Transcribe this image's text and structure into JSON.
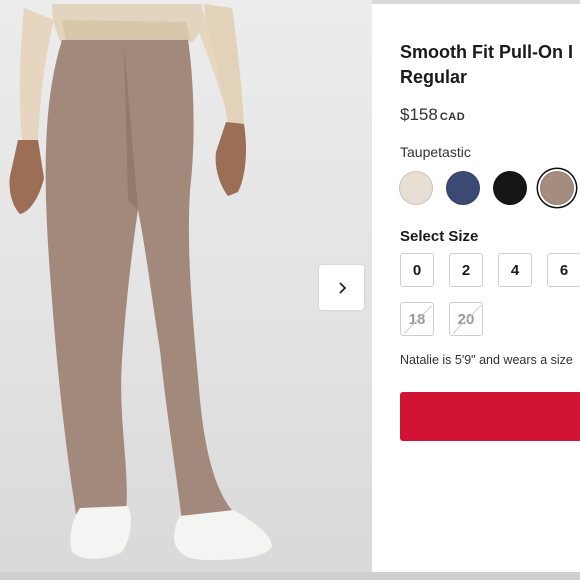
{
  "product": {
    "title_line1": "Smooth Fit Pull-On I",
    "title_line2": "Regular",
    "price": "$158",
    "currency": "CAD"
  },
  "color": {
    "selected_name": "Taupetastic",
    "swatches": [
      {
        "name": "light-beige-swatch",
        "color": "#e7dfd6",
        "selected": false
      },
      {
        "name": "navy-swatch",
        "color": "#3b4a72",
        "selected": false
      },
      {
        "name": "black-swatch",
        "color": "#161616",
        "selected": false
      },
      {
        "name": "taupe-swatch",
        "color": "#a48c7e",
        "selected": true
      }
    ]
  },
  "size": {
    "label": "Select Size",
    "row1": [
      "0",
      "2",
      "4",
      "6"
    ],
    "row2": [
      "18",
      "20"
    ]
  },
  "fit_note": "Natalie is 5'9\" and wears a size",
  "nav": {
    "next_icon": "chevron-right-icon"
  },
  "colors": {
    "cta": "#d31334",
    "pants": "#a2897b",
    "top": "#e3d4bd"
  }
}
